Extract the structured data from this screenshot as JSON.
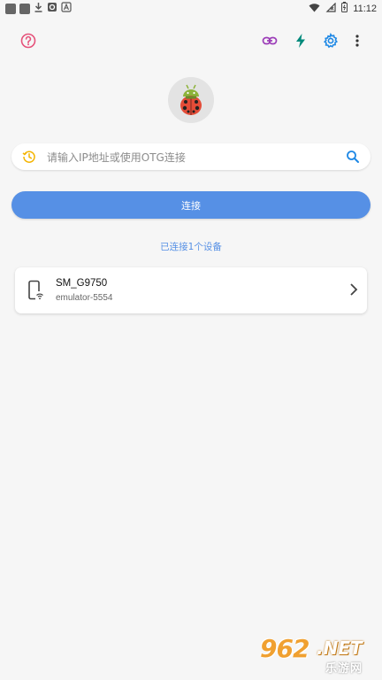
{
  "status_bar": {
    "time": "11:12",
    "left_icons": [
      "app-square-icon",
      "app-square-icon",
      "download-icon",
      "vpn-icon",
      "font-icon"
    ],
    "right_icons": [
      "wifi-icon",
      "signal-off-icon",
      "battery-icon"
    ]
  },
  "toolbar": {
    "icons": [
      "help-icon",
      "link-icon",
      "flash-icon",
      "settings-icon",
      "more-vert-icon"
    ]
  },
  "search": {
    "placeholder": "请输入IP地址或使用OTG连接",
    "value": ""
  },
  "connect_button": {
    "label": "连接"
  },
  "connected_text": "已连接1个设备",
  "devices": [
    {
      "name": "SM_G9750",
      "id": "emulator-5554"
    }
  ],
  "watermark": {
    "number": "962",
    "suffix": ".NET",
    "cn": "乐游网"
  },
  "colors": {
    "accent": "#5690E5",
    "help": "#E5517A",
    "link": "#9C3DB8",
    "flash": "#00897B",
    "settings": "#1E88E5",
    "history": "#F4B400",
    "background": "#F6F6F6"
  }
}
